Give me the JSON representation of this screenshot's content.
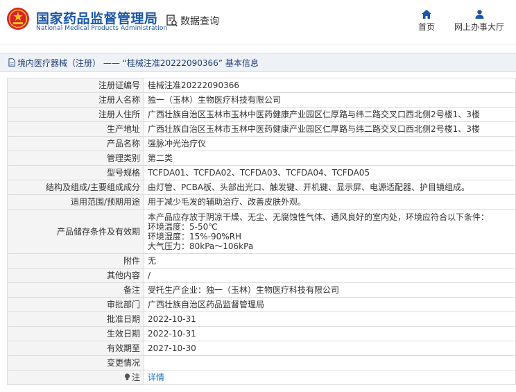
{
  "header": {
    "site_title_cn": "国家药品监督管理局",
    "site_title_en": "National Medical Products Administration",
    "query_label": "数据查询",
    "nav_home": "首页",
    "nav_office": "网上办事大厅",
    "brand_color": "#1a56a8"
  },
  "title_bar": {
    "text": "境内医疗器械（注册） —— “桂械注准20222090366” 基本信息"
  },
  "record": {
    "rows": [
      {
        "label": "注册证编号",
        "value": "桂械注准20222090366"
      },
      {
        "label": "注册人名称",
        "value": "独一（玉林）生物医疗科技有限公司"
      },
      {
        "label": "注册人住所",
        "value": "广西壮族自治区玉林市玉林中医药健康产业园区仁厚路与纬二路交叉口西北侧2号楼1、3楼"
      },
      {
        "label": "生产地址",
        "value": "广西壮族自治区玉林市玉林中医药健康产业园区仁厚路与纬二路交叉口西北侧2号楼1、3楼"
      },
      {
        "label": "产品名称",
        "value": "强脉冲光治疗仪"
      },
      {
        "label": "管理类别",
        "value": "第二类"
      },
      {
        "label": "型号规格",
        "value": "TCFDA01、TCFDA02、TCFDA03、TCFDA04、TCFDA05"
      },
      {
        "label": "结构及组成/主要组成成分",
        "value": "由灯管、PCBA板、头部出光口、触发键、开机键、显示屏、电源适配器、护目镜组成。"
      },
      {
        "label": "适用范围/预期用途",
        "value": "用于减少毛发的辅助治疗、改善皮肤外观。"
      }
    ],
    "storage": {
      "label": "产品储存条件及有效期",
      "lines": [
        "本产品应存放于阴凉干燥、无尘、无腐蚀性气体、通风良好的室内处，环境应符合以下条件：",
        "环境温度：5-50℃",
        "环境湿度：15%-90%RH",
        "大气压力：80kPa～106kPa"
      ]
    },
    "rows2": [
      {
        "label": "附件",
        "value": "无"
      },
      {
        "label": "其他内容",
        "value": "/"
      },
      {
        "label": "备注",
        "value": "受托生产企业：独一（玉林）生物医疗科技有限公司"
      },
      {
        "label": "审批部门",
        "value": "广西壮族自治区药品监督管理局"
      },
      {
        "label": "批准日期",
        "value": "2022-10-31"
      },
      {
        "label": "生效日期",
        "value": "2022-10-31"
      },
      {
        "label": "有效期至",
        "value": "2027-10-30"
      },
      {
        "label": "变更情况",
        "value": ""
      }
    ],
    "note": {
      "label": "注",
      "link": "详情"
    }
  }
}
